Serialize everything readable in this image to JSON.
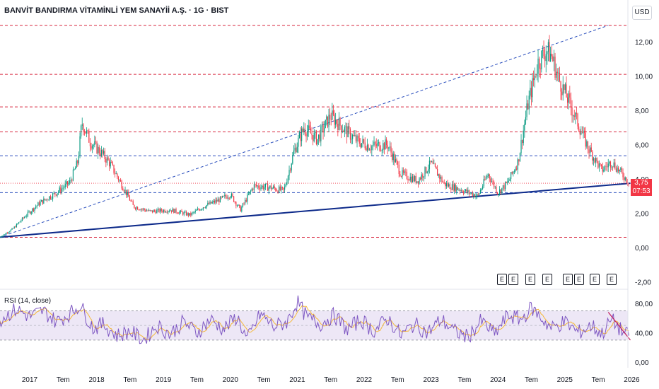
{
  "header": {
    "title": "BANVİT BANDIRMA VİTAMİNLİ YEM SANAYİİ A.Ş. · 1G · BIST",
    "currency": "USD"
  },
  "price_tag": {
    "price": "3,75",
    "countdown": "07:53"
  },
  "rsi_label": "RSI (14, close)",
  "earnings_markers": [
    "E",
    "E",
    "E",
    "E",
    "E",
    "E",
    "E",
    "E"
  ],
  "colors": {
    "up": "#089981",
    "down": "#f23645",
    "trendline": "#0d2a8a",
    "red_dashed": "#d7263d",
    "blue_dashed": "#2b4fbd",
    "rsi_line": "#7e57c2",
    "rsi_ma": "#f5b93a",
    "rsi_band": "#ede7f6"
  },
  "chart_data": [
    {
      "type": "candlestick",
      "title": "BANVİT BANDIRMA VİTAMİNLİ YEM SANAYİİ A.Ş. · 1G · BIST",
      "y_axis_ticks": [
        "12,00",
        "10,00",
        "8,00",
        "6,00",
        "4,00",
        "2,00",
        "0,00",
        "-2,00"
      ],
      "x_axis_ticks": [
        "2017",
        "Tem",
        "2018",
        "Tem",
        "2019",
        "Tem",
        "2020",
        "Tem",
        "2021",
        "Tem",
        "2022",
        "Tem",
        "2023",
        "Tem",
        "2024",
        "Tem",
        "2025",
        "Tem",
        "2026"
      ],
      "ylim": [
        -2,
        13
      ],
      "last_price": 3.75,
      "price_path": [
        {
          "x": 2016.55,
          "y": 0.6
        },
        {
          "x": 2016.75,
          "y": 1.1
        },
        {
          "x": 2016.95,
          "y": 1.9
        },
        {
          "x": 2017.15,
          "y": 2.6
        },
        {
          "x": 2017.4,
          "y": 3.2
        },
        {
          "x": 2017.6,
          "y": 3.8
        },
        {
          "x": 2017.72,
          "y": 5.0
        },
        {
          "x": 2017.78,
          "y": 7.3
        },
        {
          "x": 2017.9,
          "y": 6.2
        },
        {
          "x": 2018.05,
          "y": 5.6
        },
        {
          "x": 2018.2,
          "y": 4.9
        },
        {
          "x": 2018.4,
          "y": 3.5
        },
        {
          "x": 2018.55,
          "y": 2.4
        },
        {
          "x": 2018.8,
          "y": 2.1
        },
        {
          "x": 2019.1,
          "y": 2.2
        },
        {
          "x": 2019.4,
          "y": 1.9
        },
        {
          "x": 2019.6,
          "y": 2.4
        },
        {
          "x": 2019.85,
          "y": 2.8
        },
        {
          "x": 2020.0,
          "y": 3.1
        },
        {
          "x": 2020.15,
          "y": 2.2
        },
        {
          "x": 2020.35,
          "y": 3.6
        },
        {
          "x": 2020.6,
          "y": 3.5
        },
        {
          "x": 2020.8,
          "y": 3.3
        },
        {
          "x": 2020.95,
          "y": 5.6
        },
        {
          "x": 2021.1,
          "y": 7.0
        },
        {
          "x": 2021.3,
          "y": 6.3
        },
        {
          "x": 2021.5,
          "y": 7.7
        },
        {
          "x": 2021.7,
          "y": 6.9
        },
        {
          "x": 2021.9,
          "y": 6.2
        },
        {
          "x": 2022.1,
          "y": 5.9
        },
        {
          "x": 2022.35,
          "y": 6.0
        },
        {
          "x": 2022.55,
          "y": 4.3
        },
        {
          "x": 2022.8,
          "y": 3.9
        },
        {
          "x": 2023.0,
          "y": 4.9
        },
        {
          "x": 2023.2,
          "y": 3.7
        },
        {
          "x": 2023.5,
          "y": 3.3
        },
        {
          "x": 2023.7,
          "y": 3.0
        },
        {
          "x": 2023.85,
          "y": 4.3
        },
        {
          "x": 2024.0,
          "y": 3.2
        },
        {
          "x": 2024.15,
          "y": 3.8
        },
        {
          "x": 2024.3,
          "y": 5.0
        },
        {
          "x": 2024.45,
          "y": 8.4
        },
        {
          "x": 2024.6,
          "y": 10.8
        },
        {
          "x": 2024.72,
          "y": 11.5
        },
        {
          "x": 2024.8,
          "y": 11.2
        },
        {
          "x": 2024.9,
          "y": 9.9
        },
        {
          "x": 2025.05,
          "y": 8.6
        },
        {
          "x": 2025.2,
          "y": 7.2
        },
        {
          "x": 2025.35,
          "y": 5.8
        },
        {
          "x": 2025.55,
          "y": 4.5
        },
        {
          "x": 2025.7,
          "y": 5.0
        },
        {
          "x": 2025.85,
          "y": 4.3
        },
        {
          "x": 2025.97,
          "y": 3.75
        }
      ],
      "horizontal_levels": [
        {
          "y": 12.95,
          "style": "red-dashed"
        },
        {
          "y": 10.1,
          "style": "red-dashed"
        },
        {
          "y": 8.2,
          "style": "red-dashed"
        },
        {
          "y": 6.75,
          "style": "red-dashed"
        },
        {
          "y": 5.35,
          "style": "blue-dashed"
        },
        {
          "y": 3.2,
          "style": "blue-dashed"
        },
        {
          "y": 0.6,
          "style": "red-dashed"
        }
      ],
      "trendlines": [
        {
          "from": {
            "x": 2016.55,
            "y": 0.6
          },
          "to": {
            "x": 2025.98,
            "y": 3.75
          },
          "style": "solid-blue"
        },
        {
          "from": {
            "x": 2016.55,
            "y": 0.6
          },
          "to": {
            "x": 2025.65,
            "y": 12.95
          },
          "style": "blue-dashed"
        }
      ]
    },
    {
      "type": "line",
      "title": "RSI (14, close)",
      "y_axis_ticks": [
        "80,00",
        "40,00",
        "0,00"
      ],
      "ylim": [
        0,
        100
      ],
      "bands": [
        70,
        30
      ],
      "rsi_path": [
        {
          "x": 2016.55,
          "y": 58
        },
        {
          "x": 2016.8,
          "y": 72
        },
        {
          "x": 2017.0,
          "y": 62
        },
        {
          "x": 2017.2,
          "y": 70
        },
        {
          "x": 2017.4,
          "y": 55
        },
        {
          "x": 2017.6,
          "y": 66
        },
        {
          "x": 2017.75,
          "y": 78
        },
        {
          "x": 2017.95,
          "y": 46
        },
        {
          "x": 2018.1,
          "y": 52
        },
        {
          "x": 2018.3,
          "y": 36
        },
        {
          "x": 2018.5,
          "y": 42
        },
        {
          "x": 2018.7,
          "y": 30
        },
        {
          "x": 2018.9,
          "y": 50
        },
        {
          "x": 2019.1,
          "y": 38
        },
        {
          "x": 2019.3,
          "y": 55
        },
        {
          "x": 2019.5,
          "y": 40
        },
        {
          "x": 2019.7,
          "y": 58
        },
        {
          "x": 2019.9,
          "y": 45
        },
        {
          "x": 2020.1,
          "y": 62
        },
        {
          "x": 2020.25,
          "y": 30
        },
        {
          "x": 2020.45,
          "y": 66
        },
        {
          "x": 2020.65,
          "y": 48
        },
        {
          "x": 2020.85,
          "y": 55
        },
        {
          "x": 2021.0,
          "y": 82
        },
        {
          "x": 2021.15,
          "y": 60
        },
        {
          "x": 2021.35,
          "y": 52
        },
        {
          "x": 2021.55,
          "y": 64
        },
        {
          "x": 2021.75,
          "y": 44
        },
        {
          "x": 2021.95,
          "y": 58
        },
        {
          "x": 2022.15,
          "y": 42
        },
        {
          "x": 2022.35,
          "y": 60
        },
        {
          "x": 2022.55,
          "y": 36
        },
        {
          "x": 2022.75,
          "y": 52
        },
        {
          "x": 2022.95,
          "y": 40
        },
        {
          "x": 2023.15,
          "y": 58
        },
        {
          "x": 2023.35,
          "y": 42
        },
        {
          "x": 2023.55,
          "y": 34
        },
        {
          "x": 2023.75,
          "y": 56
        },
        {
          "x": 2023.95,
          "y": 38
        },
        {
          "x": 2024.15,
          "y": 64
        },
        {
          "x": 2024.35,
          "y": 58
        },
        {
          "x": 2024.5,
          "y": 74
        },
        {
          "x": 2024.65,
          "y": 60
        },
        {
          "x": 2024.8,
          "y": 46
        },
        {
          "x": 2025.0,
          "y": 55
        },
        {
          "x": 2025.2,
          "y": 40
        },
        {
          "x": 2025.4,
          "y": 50
        },
        {
          "x": 2025.55,
          "y": 38
        },
        {
          "x": 2025.7,
          "y": 58
        },
        {
          "x": 2025.85,
          "y": 42
        },
        {
          "x": 2025.97,
          "y": 34
        }
      ],
      "rsi_trendline": {
        "from": {
          "x": 2025.65,
          "y": 68
        },
        "to": {
          "x": 2025.98,
          "y": 30
        }
      }
    }
  ]
}
